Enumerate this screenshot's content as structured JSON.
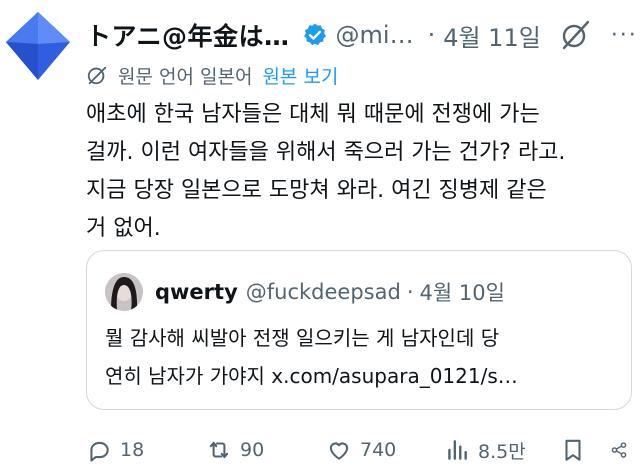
{
  "tweet": {
    "author_name": "トアニ@年金は…",
    "handle": "@mi…",
    "separator": "·",
    "date": "4월 11일",
    "more": "···",
    "translate_label": "원문 언어 일본어",
    "translate_link": "원본 보기",
    "body_lines": [
      "애초에 한국 남자들은 대체 뭐 때문에 전쟁에 가는",
      "걸까. 이런 여자들을 위해서 죽으러 가는 건가? 라고.",
      "지금 당장 일본으로 도망쳐 와라. 여긴 징병제 같은",
      "거 없어."
    ]
  },
  "quote": {
    "author_name": "qwerty",
    "handle": "@fuckdeepsad",
    "separator": "·",
    "date": "4월 10일",
    "body_lines": [
      "뭘 감사해 씨발아 전쟁 일으키는 게 남자인데 당",
      "연히 남자가 가야지 x.com/asupara_0121/s…"
    ]
  },
  "actions": {
    "replies": "18",
    "retweets": "90",
    "likes": "740",
    "views": "8.5만"
  },
  "colors": {
    "accent": "#1d9bf0",
    "muted": "#536471",
    "avatar_blue": "#3f6fe8"
  },
  "icons": [
    "verified-badge-icon",
    "grok-icon",
    "translate-icon",
    "reply-icon",
    "retweet-icon",
    "like-icon",
    "views-icon",
    "bookmark-icon",
    "share-icon"
  ]
}
